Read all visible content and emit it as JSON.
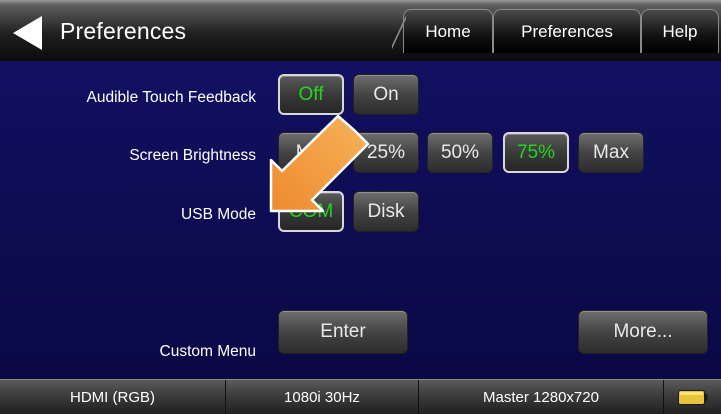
{
  "header": {
    "title": "Preferences",
    "tabs": {
      "home": "Home",
      "preferences": "Preferences",
      "help": "Help"
    }
  },
  "settings": {
    "audible": {
      "label": "Audible Touch Feedback",
      "off": "Off",
      "on": "On",
      "selected": "Off"
    },
    "brightness": {
      "label": "Screen Brightness",
      "min": "Min",
      "p25": "25%",
      "p50": "50%",
      "p75": "75%",
      "max": "Max",
      "selected": "75%"
    },
    "usb": {
      "label": "USB Mode",
      "com": "COM",
      "disk": "Disk",
      "selected": "COM"
    },
    "custom_menu": {
      "label": "Custom Menu",
      "enter": "Enter"
    },
    "more": "More..."
  },
  "status": {
    "video": "HDMI (RGB)",
    "format": "1080i 30Hz",
    "timing": "Master 1280x720",
    "battery_icon": "battery-icon"
  },
  "colors": {
    "selected_text": "#22d61c",
    "background": "#131268",
    "arrow": "#f39a3c"
  }
}
